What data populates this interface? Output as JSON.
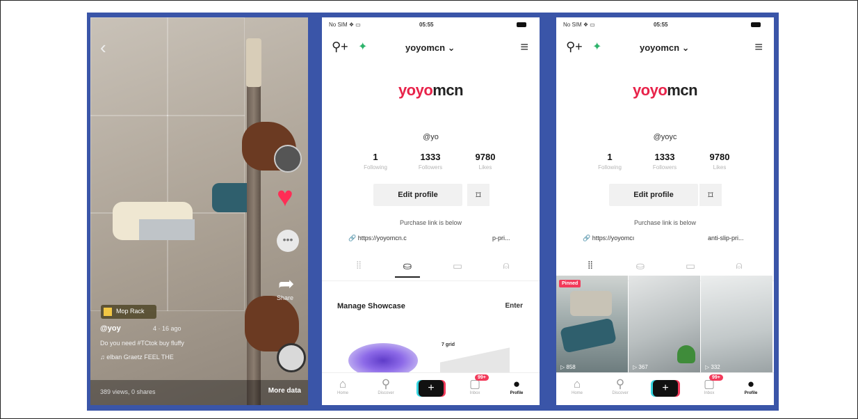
{
  "video": {
    "badge_label": "Mop Rack",
    "username": "@yoy",
    "time_ago": "4 · 16 ago",
    "description": "Do you need #TCtok buy fluffy",
    "sound": "elban Graetz   FEEL THE",
    "share_label": "Share",
    "views": "389 views, 0 shares",
    "more_label": "More data"
  },
  "profiles": [
    {
      "status": {
        "carrier": "No SIM ❖ ▭",
        "time": "05:55"
      },
      "handle": "yoyomcn ⌄",
      "logo_main": "yoyo",
      "logo_tail": "mcn",
      "at_name": "@yo",
      "stats": [
        {
          "num": "1",
          "label": "Following"
        },
        {
          "num": "1333",
          "label": "Followers"
        },
        {
          "num": "9780",
          "label": "Likes"
        }
      ],
      "edit_label": "Edit profile",
      "purchase_text": "Purchase link is below",
      "link_left": "🔗 https://yoyomcn.c",
      "link_right": "p-pri...",
      "showcase_title": "Manage Showcase",
      "showcase_action": "Enter",
      "grid_label": "7 grid",
      "nav": {
        "home": "Home",
        "discover": "Discover",
        "inbox": "Inbox",
        "inbox_badge": "99+",
        "profile": "Profile"
      }
    },
    {
      "status": {
        "carrier": "No SIM ❖ ▭",
        "time": "05:55"
      },
      "handle": "yoyomcn ⌄",
      "logo_main": "yoyo",
      "logo_tail": "mcn",
      "at_name": "@yoyc",
      "stats": [
        {
          "num": "1",
          "label": "Following"
        },
        {
          "num": "1333",
          "label": "Followers"
        },
        {
          "num": "9780",
          "label": "Likes"
        }
      ],
      "edit_label": "Edit profile",
      "purchase_text": "Purchase link is below",
      "link_left": "🔗 https://yoyomcı",
      "link_right": "anti-slip-pri...",
      "pinned_label": "Pinned",
      "video_counts": [
        "▷ 858",
        "▷ 367",
        "▷ 332"
      ],
      "nav": {
        "home": "Home",
        "discover": "Discover",
        "inbox": "Inbox",
        "inbox_badge": "99+",
        "profile": "Profile"
      }
    }
  ],
  "colors": {
    "brand": "#e8234a",
    "background": "#3a55a8",
    "heart": "#ff2d55"
  }
}
